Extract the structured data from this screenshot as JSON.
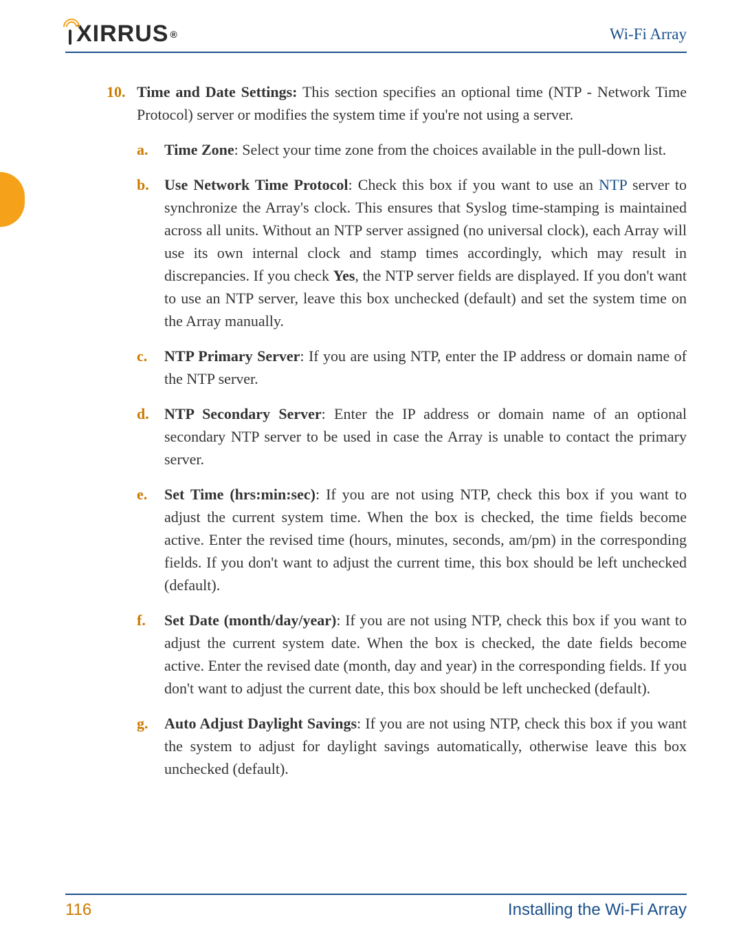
{
  "header": {
    "logo_text": "XIRRUS",
    "logo_reg": "®",
    "product": "Wi-Fi Array"
  },
  "main": {
    "item_num": "10.",
    "item_title": "Time and Date Settings:",
    "item_text": " This section specifies an optional time (NTP - Network Time Protocol) server or modifies the system time if you're not using a server.",
    "sub": {
      "a": {
        "letter": "a.",
        "title": "Time Zone",
        "text": ": Select your time zone from the choices available in the pull-down list."
      },
      "b": {
        "letter": "b.",
        "title": "Use Network Time Protocol",
        "prefix": ": Check this box if you want to use an ",
        "link": "NTP",
        "mid": " server to synchronize the Array's clock. This ensures that Syslog time-stamping is maintained across all units. Without an NTP server assigned (no universal clock), each Array will use its own internal clock and stamp times accordingly, which may result in discrepancies. If you check ",
        "yes": "Yes",
        "suffix": ", the NTP server fields are displayed. If you don't want to use an NTP server, leave this box unchecked (default) and set the system time on the Array manually."
      },
      "c": {
        "letter": "c.",
        "title": "NTP Primary Server",
        "text": ": If you are using NTP, enter the IP address or domain name of the NTP server."
      },
      "d": {
        "letter": "d.",
        "title": "NTP Secondary Server",
        "text": ": Enter the IP address or domain name of an optional secondary NTP server to be used in case the Array is unable to contact the primary server."
      },
      "e": {
        "letter": "e.",
        "title": "Set Time (hrs:min:sec)",
        "text": ": If you are not using NTP, check this box if you want to adjust the current system time. When the box is checked, the time fields become active. Enter the revised time (hours, minutes, seconds, am/pm) in the corresponding fields. If you don't want to adjust the current time, this box should be left unchecked (default)."
      },
      "f": {
        "letter": "f.",
        "title": "Set Date (month/day/year)",
        "text": ": If you are not using NTP, check this box if you want to adjust the current system date. When the box is checked, the date fields become active. Enter the revised date (month, day and year) in the corresponding fields. If you don't want to adjust the current date, this box should be left unchecked (default)."
      },
      "g": {
        "letter": "g.",
        "title": "Auto Adjust Daylight Savings",
        "text": ": If you are not using NTP, check this box if you want the system to adjust for daylight savings automatically, otherwise leave this box unchecked (default)."
      }
    }
  },
  "footer": {
    "page": "116",
    "section": "Installing the Wi-Fi Array"
  }
}
